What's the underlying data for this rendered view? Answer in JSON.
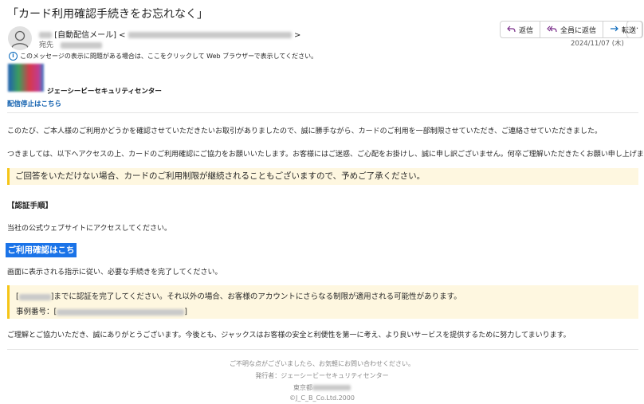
{
  "email": {
    "subject": "「カード利用確認手続きをお忘れなく」",
    "sender_tag": "[自動配信メール] <",
    "sender_close": ">",
    "to_label": "宛先",
    "date": "2024/11/07 (木) ",
    "info_bar": "このメッセージの表示に問題がある場合は、ここをクリックして Web ブラウザーで表示してください。"
  },
  "actions": {
    "reply": "返信",
    "reply_all": "全員に返信",
    "forward": "転送",
    "more": "···"
  },
  "brand": {
    "name": "ジェーシービーセキュリティセンター",
    "unsubscribe": "配信停止はこちら"
  },
  "body": {
    "p1": "このたび、ご本人様のご利用かどうかを確認させていただきたいお取引がありましたので、誠に勝手ながら、カードのご利用を一部制限させていただき、ご連絡させていただきました。",
    "p2": "つきましては、以下へアクセスの上、カードのご利用確認にご協力をお願いいたします。お客様にはご迷惑、ご心配をお掛けし、誠に申し訳ございません。何卒ご理解いただきたくお願い申し上げます。",
    "warning1": "ご回答をいただけない場合、カードのご利用制限が継続されることもございますので、予めご了承ください。",
    "section_heading": "【認証手順】",
    "p3": "当社の公式ウェブサイトにアクセスしてください。",
    "cta": "ご利用確認はこちら",
    "p4": "画面に表示される指示に従い、必要な手続きを完了してください。",
    "warning2_open": "[",
    "warning2_text": "]までに認証を完了してください。それ以外の場合、お客様のアカウントにさらなる制限が適用される可能性があります。",
    "ref_label": "事例番号：[",
    "ref_close": "]",
    "p5": "ご理解とご協力いただき、誠にありがとうございます。今後とも、ジャックスはお客様の安全と利便性を第一に考え、より良いサービスを提供するために努力してまいります。"
  },
  "footer": {
    "line1": "ご不明な点がございましたら、お気軽にお問い合わせください。",
    "line2": "発行者：ジェーシービーセキュリティセンター",
    "line3": "東京都",
    "copyright": "©J_C_B_Co.Ltd.2000"
  },
  "colors": {
    "accent": "#1a73e8",
    "warning_bg": "#fef7e0",
    "warning_bar": "#f5c518",
    "link": "#0b5cad"
  }
}
